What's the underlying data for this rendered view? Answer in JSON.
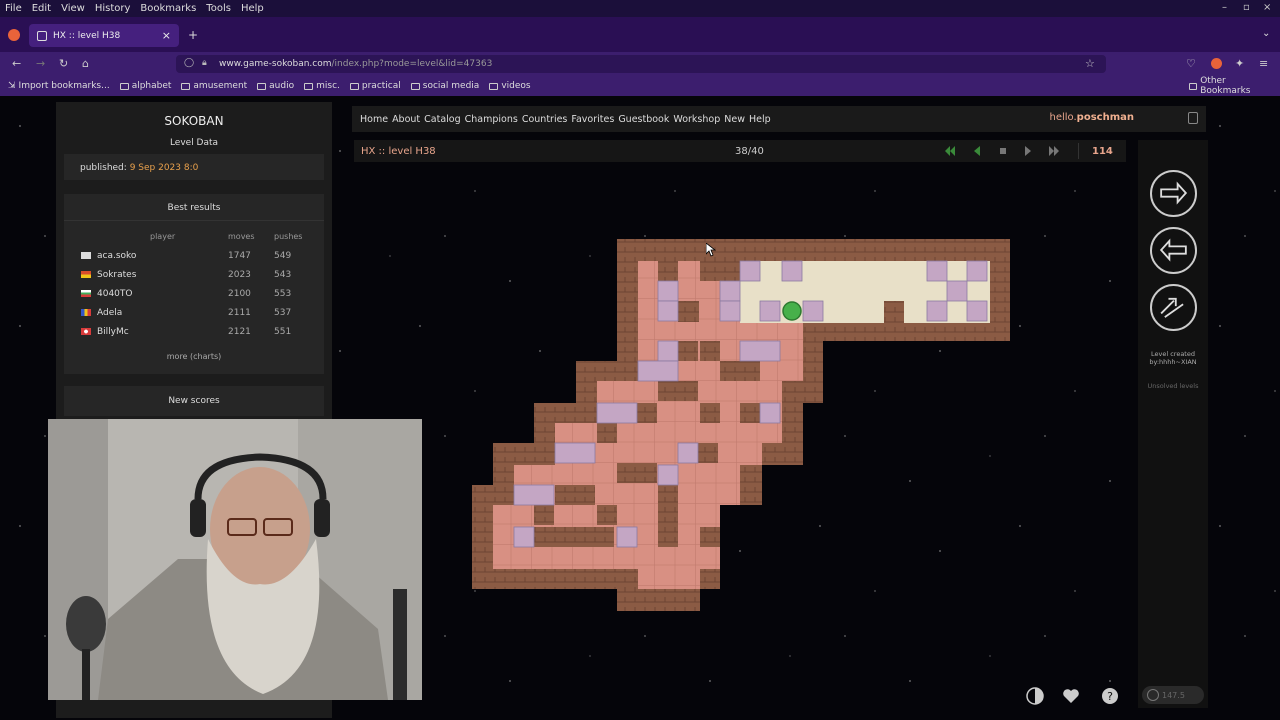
{
  "browser": {
    "menu": [
      "File",
      "Edit",
      "View",
      "History",
      "Bookmarks",
      "Tools",
      "Help"
    ],
    "tab_title": "HX :: level H38",
    "tab_close": "×",
    "new_tab": "+",
    "url_domain": "www.game-sokoban.com",
    "url_path": "/index.php?mode=level&lid=47363",
    "bookmarks": [
      "Import bookmarks...",
      "alphabet",
      "amusement",
      "audio",
      "misc.",
      "practical",
      "social media",
      "videos"
    ],
    "other_bookmarks": "Other Bookmarks",
    "accent": "#2a0f54"
  },
  "sidebar": {
    "title": "SOKOBAN",
    "subtitle": "Level Data",
    "published_label": "published:",
    "published_date": "9 Sep 2023 8:0",
    "best_title": "Best results",
    "headers": {
      "player": "player",
      "moves": "moves",
      "pushes": "pushes"
    },
    "results": [
      {
        "player": "aca.soko",
        "moves": "1747",
        "pushes": "549",
        "flag": "#dcdcdc"
      },
      {
        "player": "Sokrates",
        "moves": "2023",
        "pushes": "543",
        "flag": "#d94d2b"
      },
      {
        "player": "4040TO",
        "moves": "2100",
        "pushes": "553",
        "flag": "#3fae5a"
      },
      {
        "player": "Adela",
        "moves": "2111",
        "pushes": "537",
        "flag": "#3356c8"
      },
      {
        "player": "BillyMc",
        "moves": "2121",
        "pushes": "551",
        "flag": "#d83b3b"
      }
    ],
    "more_label": "more",
    "charts_label": "(charts)",
    "new_scores": "New scores"
  },
  "nav": {
    "items": [
      "Home",
      "About",
      "Catalog",
      "Champions",
      "Countries",
      "Favorites",
      "Guestbook",
      "Workshop",
      "New",
      "Help"
    ],
    "hello_prefix": "hello.",
    "username": "poschman"
  },
  "level": {
    "name": "HX :: level H38",
    "position": "38/40",
    "number": "114"
  },
  "right_panel": {
    "created_label": "Level created by:hhhh~XIAN",
    "unsolved_label": "Unsolved levels",
    "timer": "147.5"
  },
  "icons": {
    "next": "arrow-right-icon",
    "prev": "arrow-left-icon",
    "toggle": "contrast-icon",
    "favorite": "heart-icon",
    "help": "question-icon"
  }
}
